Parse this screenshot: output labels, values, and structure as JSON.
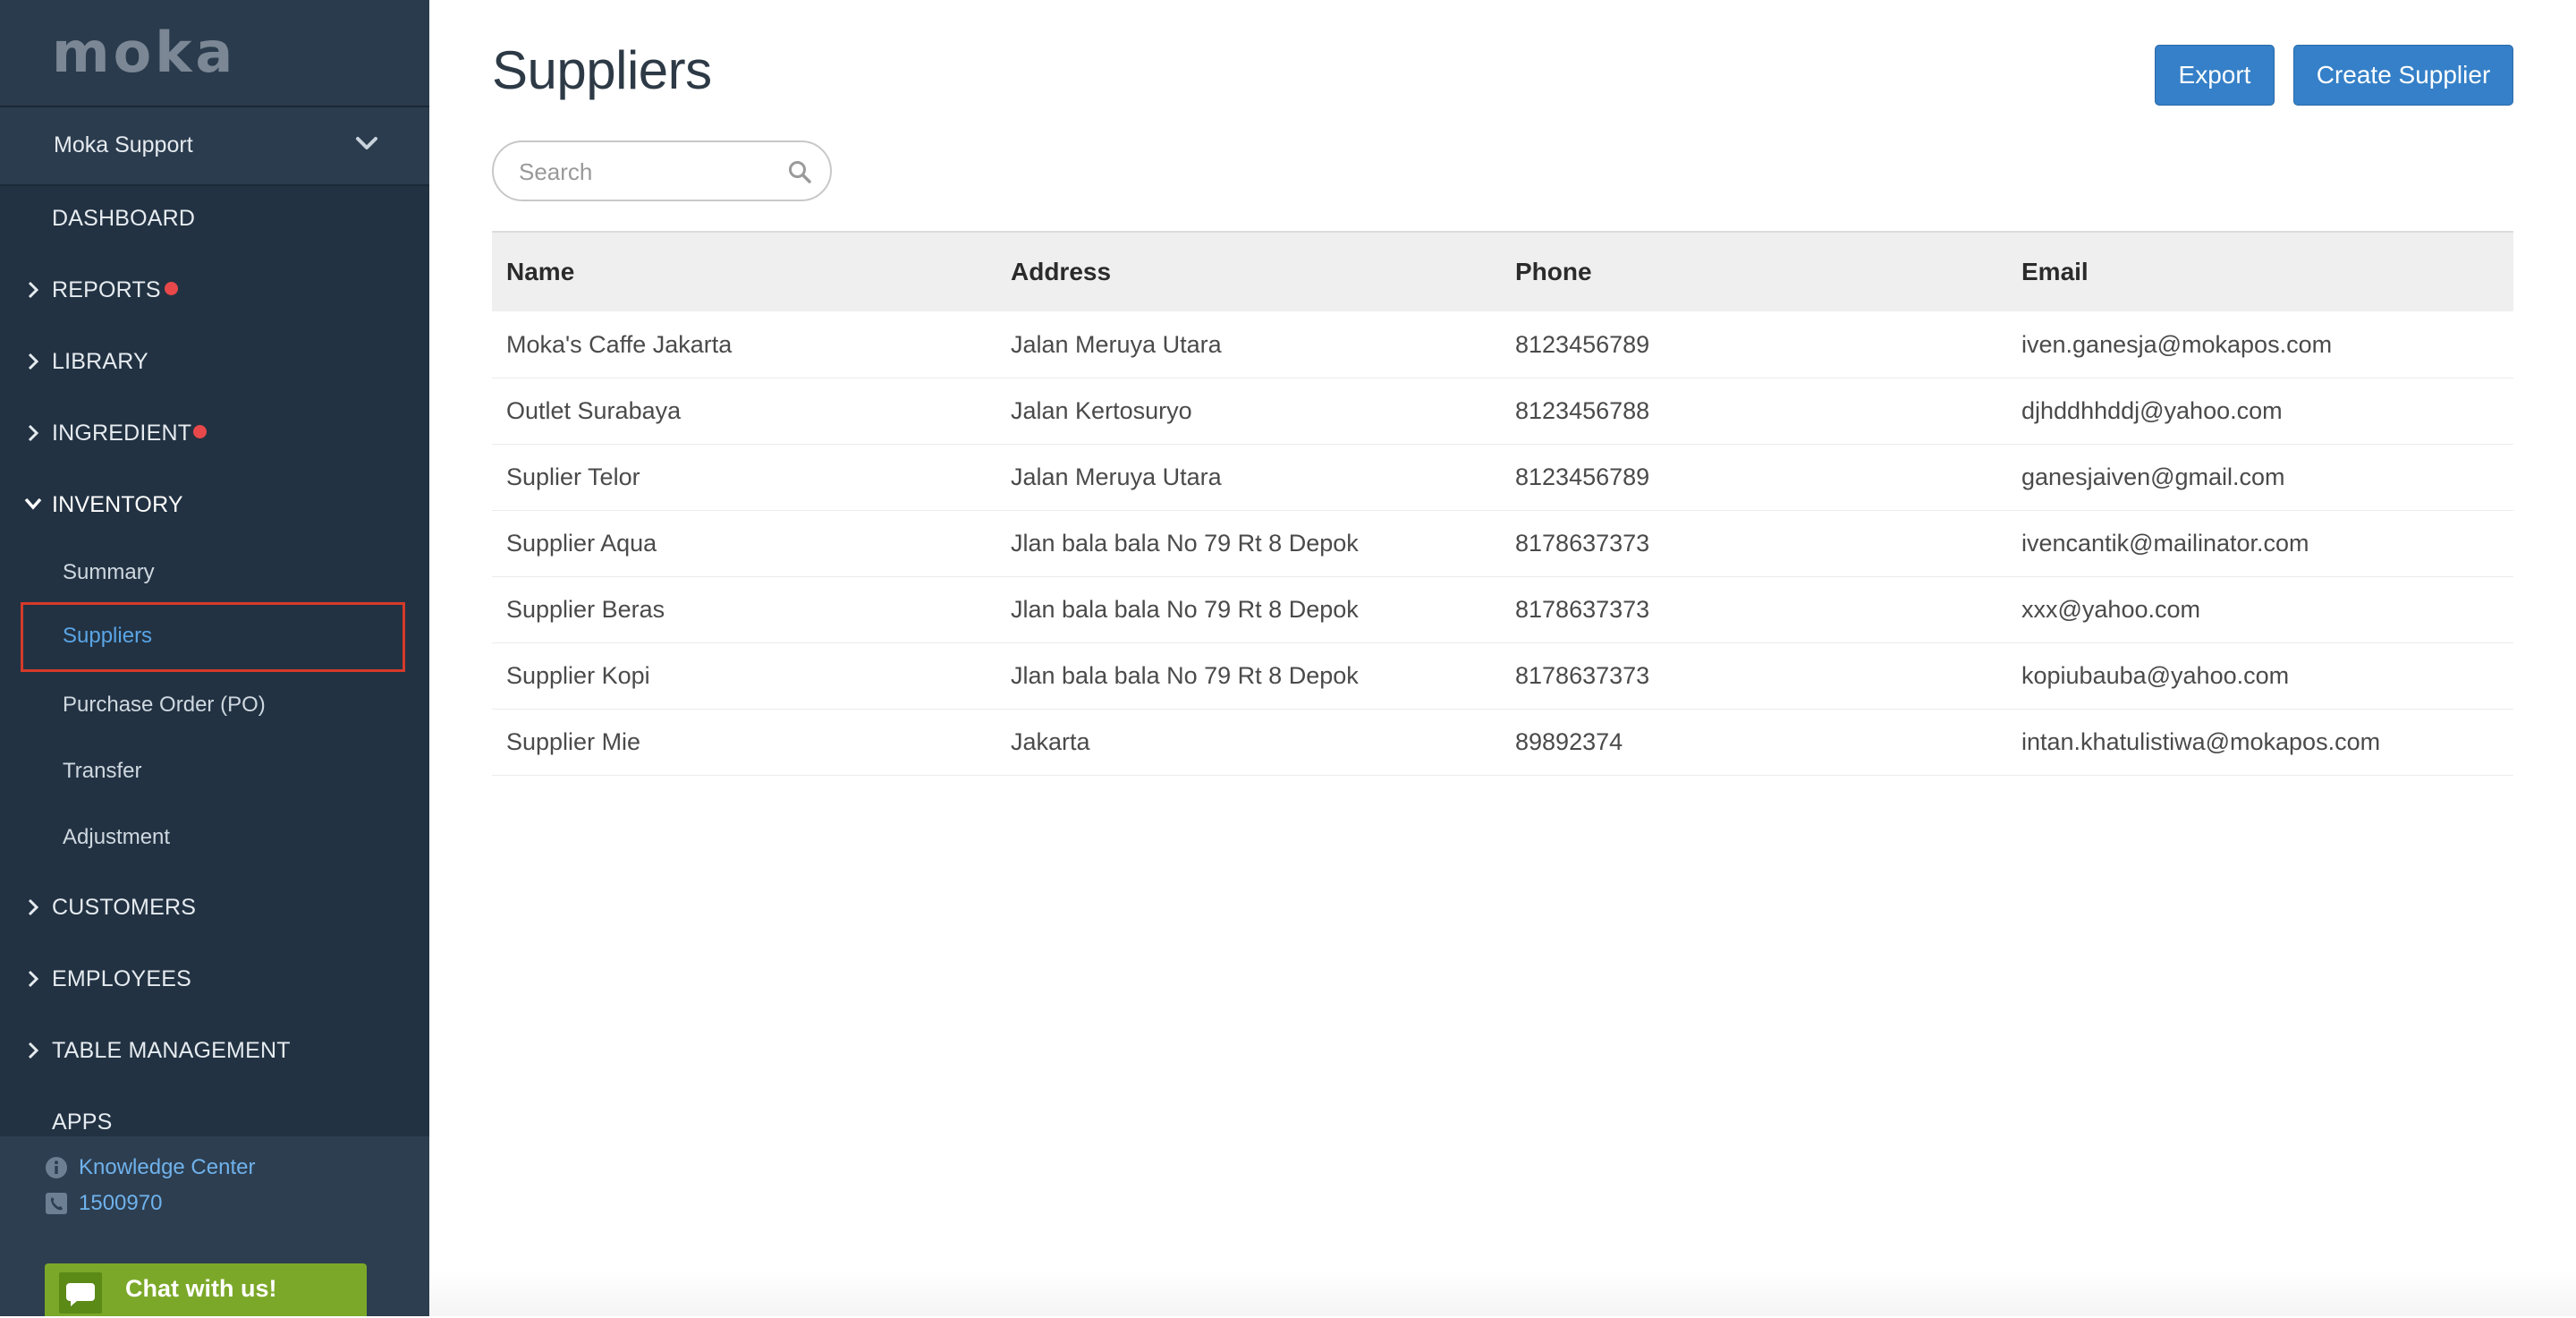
{
  "sidebar": {
    "logo": "moka",
    "account": "Moka Support",
    "nav": {
      "dashboard": "DASHBOARD",
      "reports": "REPORTS",
      "library": "LIBRARY",
      "ingredient": "INGREDIENT",
      "inventory": "INVENTORY",
      "customers": "CUSTOMERS",
      "employees": "EMPLOYEES",
      "table_management": "TABLE MANAGEMENT",
      "apps": "APPS"
    },
    "inventory_sub": [
      "Summary",
      "Suppliers",
      "Purchase Order (PO)",
      "Transfer",
      "Adjustment"
    ],
    "active_sub": "Suppliers",
    "footer": {
      "knowledge_center": "Knowledge Center",
      "phone": "1500970",
      "chat": "Chat with us!"
    }
  },
  "icons": {
    "account": "chevron-down-icon",
    "nav_collapsed": "chevron-right-icon",
    "nav_expanded": "chevron-down-icon",
    "notification": "red-dot-icon",
    "knowledge": "info-icon",
    "phone": "phone-icon",
    "chat": "chat-bubble-icon",
    "search": "search-icon"
  },
  "main": {
    "title": "Suppliers",
    "export_label": "Export",
    "create_label": "Create Supplier",
    "search_placeholder": "Search",
    "table": {
      "headers": [
        "Name",
        "Address",
        "Phone",
        "Email"
      ],
      "rows": [
        [
          "Moka's Caffe Jakarta",
          "Jalan Meruya Utara",
          "8123456789",
          "iven.ganesja@mokapos.com"
        ],
        [
          "Outlet Surabaya",
          "Jalan Kertosuryo",
          "8123456788",
          "djhddhhddj@yahoo.com"
        ],
        [
          "Suplier Telor",
          "Jalan Meruya Utara",
          "8123456789",
          "ganesjaiven@gmail.com"
        ],
        [
          "Supplier Aqua",
          "Jlan bala bala No 79 Rt 8 Depok",
          "8178637373",
          "ivencantik@mailinator.com"
        ],
        [
          "Supplier Beras",
          "Jlan bala bala No 79 Rt 8 Depok",
          "8178637373",
          "xxx@yahoo.com"
        ],
        [
          "Supplier Kopi",
          "Jlan bala bala No 79 Rt 8 Depok",
          "8178637373",
          "kopiubauba@yahoo.com"
        ],
        [
          "Supplier Mie",
          "Jakarta",
          "89892374",
          "intan.khatulistiwa@mokapos.com"
        ]
      ]
    }
  },
  "colors": {
    "sidebar_bg": "#223242",
    "accent_blue": "#3580c8",
    "active_link": "#5aa5e6",
    "notification_dot": "#e8484a",
    "highlight_box": "#d63a2a",
    "chat_green": "#7ba829"
  }
}
